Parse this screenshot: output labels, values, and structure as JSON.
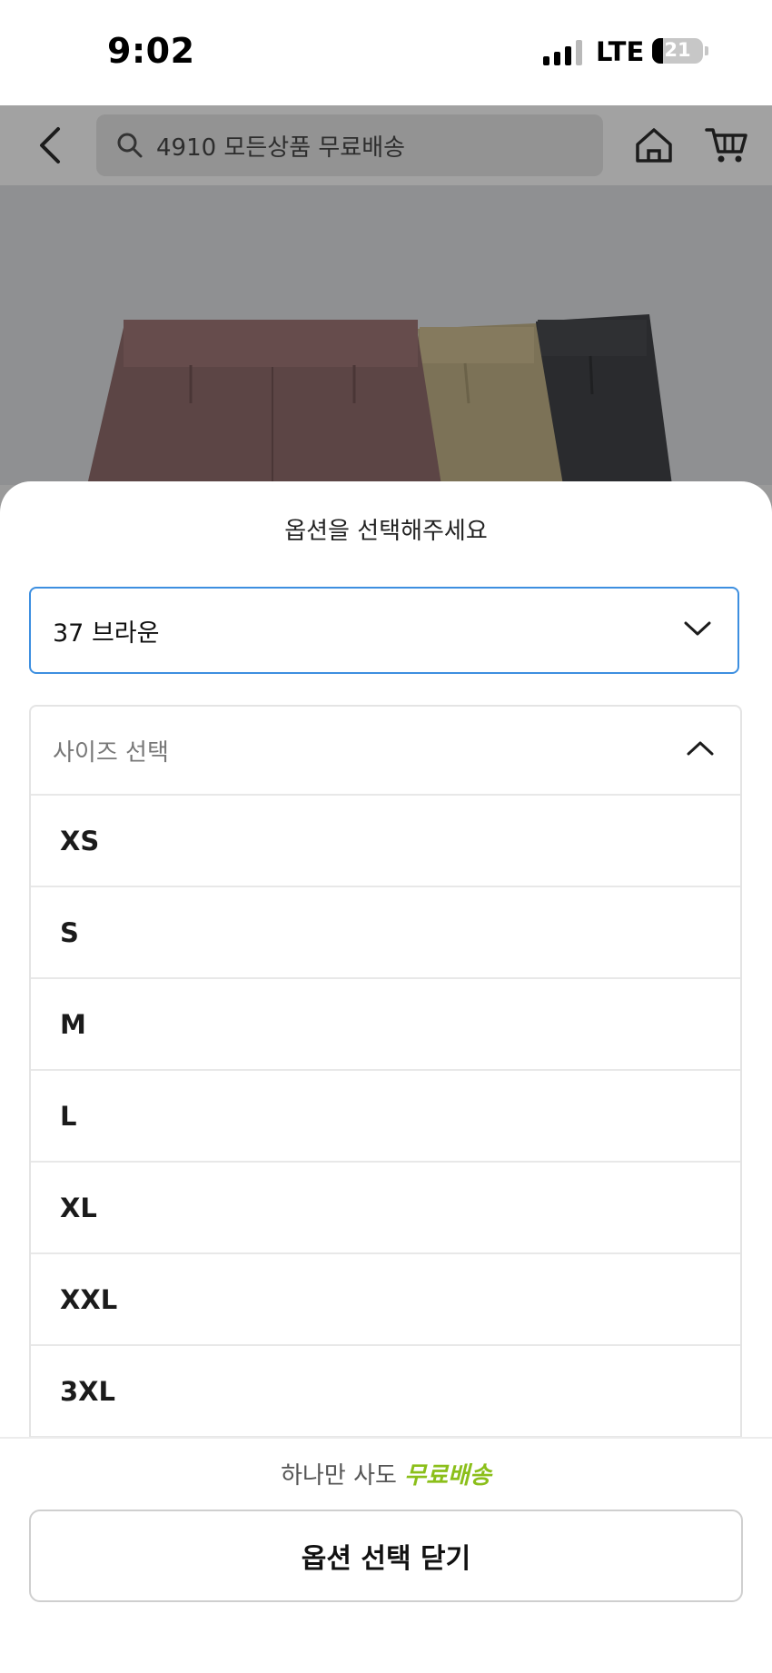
{
  "status_bar": {
    "time": "9:02",
    "network": "LTE",
    "battery_percent": "21"
  },
  "topnav": {
    "search_placeholder": "4910 모든상품 무료배송",
    "icons": [
      "back-arrow-icon",
      "search-icon",
      "home-icon",
      "cart-icon"
    ]
  },
  "sheet": {
    "title": "옵션을 선택해주세요",
    "color_select": {
      "value": "37 브라운",
      "icon": "chevron-down-icon"
    },
    "size_select": {
      "label": "사이즈 선택",
      "icon": "chevron-up-icon",
      "options": [
        "XS",
        "S",
        "M",
        "L",
        "XL",
        "XXL",
        "3XL"
      ]
    },
    "promo": {
      "prefix": "하나만 사도",
      "highlight": "무료배송"
    },
    "close_button_label": "옵션 선택 닫기"
  },
  "colors": {
    "accent_border": "#3d8fe0",
    "promo_green": "#8bbf1a",
    "overlay_gray": "#9a9a9a"
  }
}
